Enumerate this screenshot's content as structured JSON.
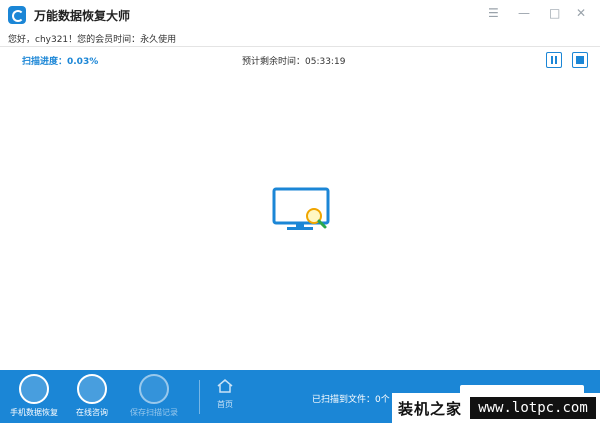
{
  "app": {
    "title": "万能数据恢复大师"
  },
  "window_controls": {
    "menu": "☰",
    "minimize": "—",
    "maximize": "□",
    "close": "✕"
  },
  "user_info": {
    "text": "您好，chy321！您的会员时间：永久使用"
  },
  "scan": {
    "progress_label": "扫描进度：0.03%",
    "progress_value": 0.03,
    "eta_label": "预计剩余时间：05:33:19"
  },
  "footer": {
    "items": [
      {
        "label": "手机数据恢复"
      },
      {
        "label": "在线咨询"
      },
      {
        "label": "保存扫描记录"
      }
    ],
    "home_label": "首页",
    "scanned_label": "已扫描到文件：0个"
  },
  "watermark": {
    "cn": "装机之家",
    "url": "www.lotpc.com"
  },
  "colors": {
    "accent": "#1b86d6"
  }
}
